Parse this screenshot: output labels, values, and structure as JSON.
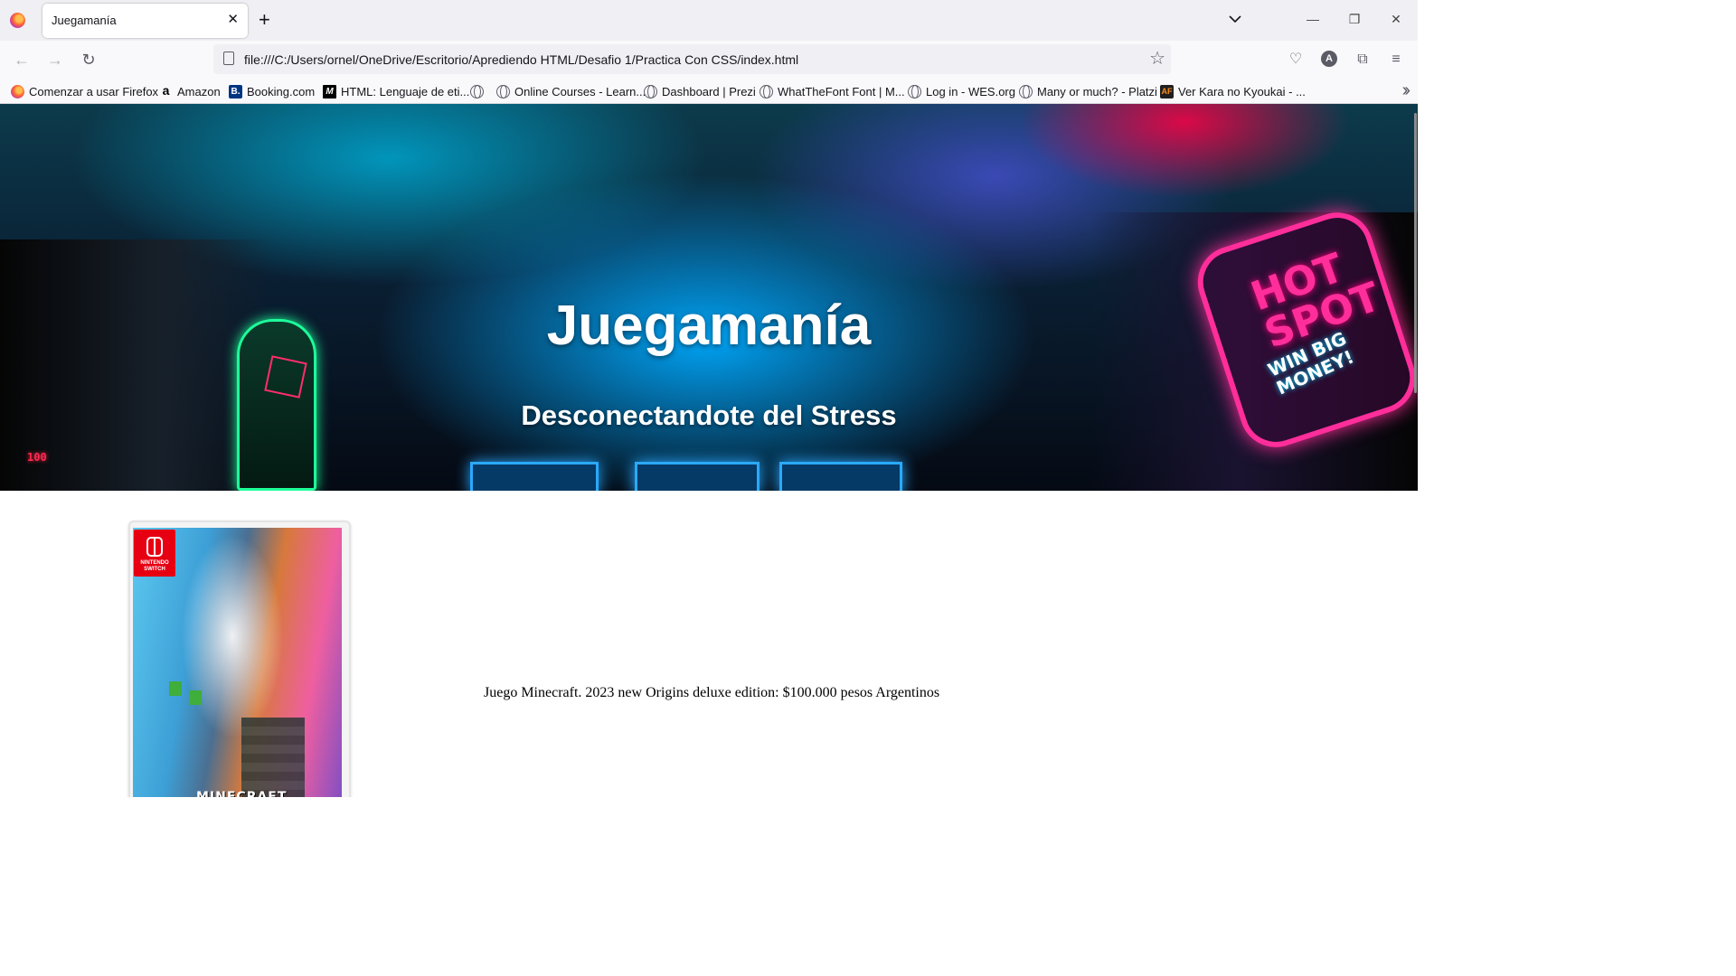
{
  "browser": {
    "tab": {
      "title": "Juegamanía",
      "close_glyph": "✕"
    },
    "new_tab_glyph": "+",
    "url": "file:///C:/Users/ornel/OneDrive/Escritorio/Aprediendo HTML/Desafio 1/Practica Con CSS/index.html",
    "window_controls": {
      "minimize": "—",
      "restore": "❐",
      "close": "✕"
    },
    "account_initial": "A",
    "bookmarks": [
      {
        "label": "Comenzar a usar Firefox",
        "icon": "firefox-icon"
      },
      {
        "label": "Amazon",
        "icon": "amazon-icon"
      },
      {
        "label": "Booking.com",
        "icon": "booking-icon"
      },
      {
        "label": "HTML: Lenguaje de eti...",
        "icon": "mdn-icon"
      },
      {
        "label": "",
        "icon": "globe-icon"
      },
      {
        "label": "Online Courses - Learn...",
        "icon": "globe-icon"
      },
      {
        "label": "Dashboard | Prezi",
        "icon": "globe-icon"
      },
      {
        "label": "WhatTheFont Font | M...",
        "icon": "globe-icon"
      },
      {
        "label": "Log in - WES.org",
        "icon": "globe-icon"
      },
      {
        "label": "Many or much? - Platzi",
        "icon": "globe-icon"
      },
      {
        "label": "Ver Kara no Kyoukai - ...",
        "icon": "animeflv-icon"
      }
    ]
  },
  "page": {
    "hero": {
      "title": "Juegamanía",
      "subtitle": "Desconectandote del Stress",
      "sign_text": "HOT SPOT",
      "sign_subtext": "WIN BIG MONEY!",
      "digits": "100"
    },
    "product": {
      "image_alt": "Minecraft Legends Nintendo Switch cover",
      "platform_badge": "NINTENDO SWITCH",
      "cover_title": "MINECRAFT",
      "description": "Juego Minecraft. 2023 new Origins deluxe edition: $100.000 pesos Argentinos"
    }
  }
}
